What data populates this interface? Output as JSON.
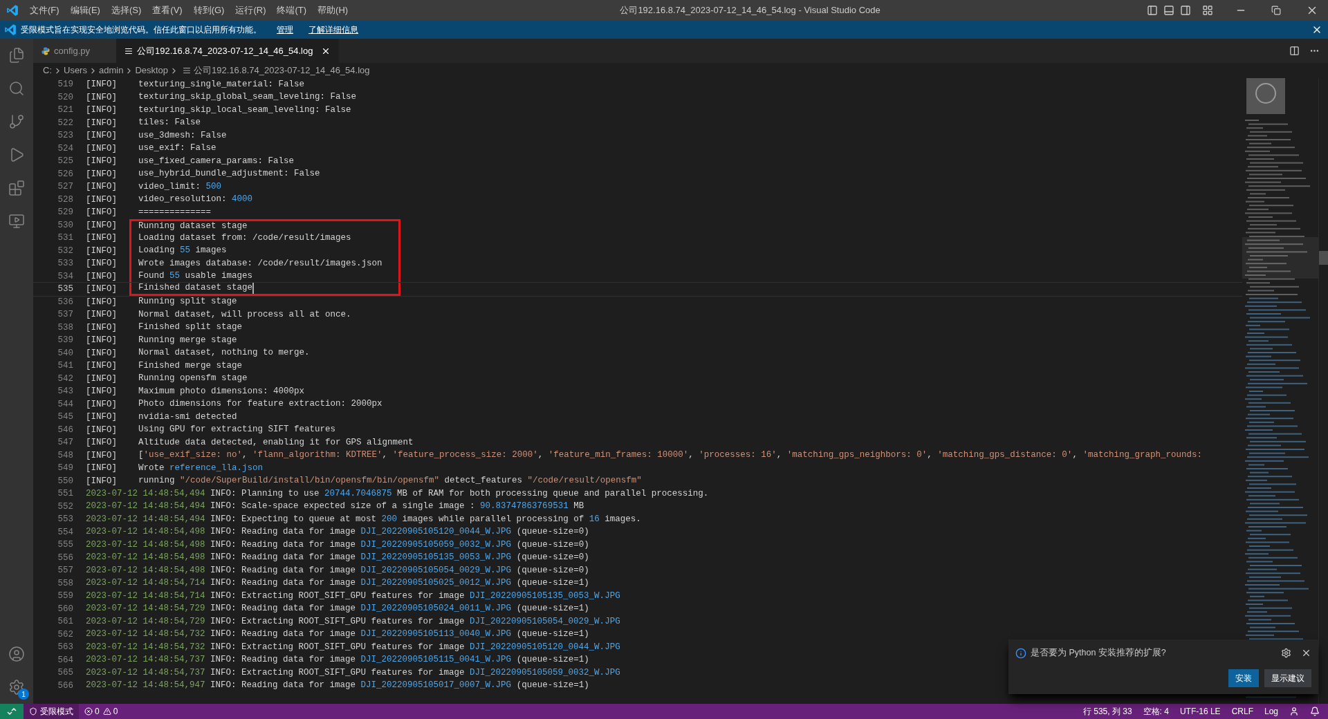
{
  "window": {
    "title": "公司192.16.8.74_2023-07-12_14_46_54.log - Visual Studio Code"
  },
  "menu": [
    "文件(F)",
    "编辑(E)",
    "选择(S)",
    "查看(V)",
    "转到(G)",
    "运行(R)",
    "终端(T)",
    "帮助(H)"
  ],
  "banner": {
    "text": "受限模式旨在实现安全地浏览代码。信任此窗口以启用所有功能。",
    "links": [
      "管理",
      "了解详细信息"
    ]
  },
  "activity_bar": {
    "settings_badge": "1"
  },
  "tabs": [
    {
      "label": "config.py",
      "kind": "python",
      "selected": false
    },
    {
      "label": "公司192.16.8.74_2023-07-12_14_46_54.log",
      "kind": "log",
      "selected": true
    }
  ],
  "breadcrumb": [
    "C:",
    "Users",
    "admin",
    "Desktop",
    "公司192.16.8.74_2023-07-12_14_46_54.log"
  ],
  "lines": [
    {
      "n": "519",
      "level": "[INFO]",
      "current": false,
      "boxed": false,
      "msg": [
        {
          "kind": "plain",
          "text": "texturing_single_material: False"
        }
      ]
    },
    {
      "n": "520",
      "level": "[INFO]",
      "current": false,
      "boxed": false,
      "msg": [
        {
          "kind": "plain",
          "text": "texturing_skip_global_seam_leveling: False"
        }
      ]
    },
    {
      "n": "521",
      "level": "[INFO]",
      "current": false,
      "boxed": false,
      "msg": [
        {
          "kind": "plain",
          "text": "texturing_skip_local_seam_leveling: False"
        }
      ]
    },
    {
      "n": "522",
      "level": "[INFO]",
      "current": false,
      "boxed": false,
      "msg": [
        {
          "kind": "plain",
          "text": "tiles: False"
        }
      ]
    },
    {
      "n": "523",
      "level": "[INFO]",
      "current": false,
      "boxed": false,
      "msg": [
        {
          "kind": "plain",
          "text": "use_3dmesh: False"
        }
      ]
    },
    {
      "n": "524",
      "level": "[INFO]",
      "current": false,
      "boxed": false,
      "msg": [
        {
          "kind": "plain",
          "text": "use_exif: False"
        }
      ]
    },
    {
      "n": "525",
      "level": "[INFO]",
      "current": false,
      "boxed": false,
      "msg": [
        {
          "kind": "plain",
          "text": "use_fixed_camera_params: False"
        }
      ]
    },
    {
      "n": "526",
      "level": "[INFO]",
      "current": false,
      "boxed": false,
      "msg": [
        {
          "kind": "plain",
          "text": "use_hybrid_bundle_adjustment: False"
        }
      ]
    },
    {
      "n": "527",
      "level": "[INFO]",
      "current": false,
      "boxed": false,
      "msg": [
        {
          "kind": "plain",
          "text": "video_limit: "
        },
        {
          "kind": "number",
          "text": "500"
        }
      ]
    },
    {
      "n": "528",
      "level": "[INFO]",
      "current": false,
      "boxed": false,
      "msg": [
        {
          "kind": "plain",
          "text": "video_resolution: "
        },
        {
          "kind": "number",
          "text": "4000"
        }
      ]
    },
    {
      "n": "529",
      "level": "[INFO]",
      "current": false,
      "boxed": false,
      "msg": [
        {
          "kind": "plain",
          "text": "=============="
        }
      ]
    },
    {
      "n": "530",
      "level": "[INFO]",
      "current": false,
      "boxed": true,
      "msg": [
        {
          "kind": "plain",
          "text": "Running dataset stage"
        }
      ]
    },
    {
      "n": "531",
      "level": "[INFO]",
      "current": false,
      "boxed": true,
      "msg": [
        {
          "kind": "plain",
          "text": "Loading dataset from: /code/result/images"
        }
      ]
    },
    {
      "n": "532",
      "level": "[INFO]",
      "current": false,
      "boxed": true,
      "msg": [
        {
          "kind": "plain",
          "text": "Loading "
        },
        {
          "kind": "number",
          "text": "55"
        },
        {
          "kind": "plain",
          "text": " images"
        }
      ]
    },
    {
      "n": "533",
      "level": "[INFO]",
      "current": false,
      "boxed": true,
      "msg": [
        {
          "kind": "plain",
          "text": "Wrote images database: /code/result/images.json"
        }
      ]
    },
    {
      "n": "534",
      "level": "[INFO]",
      "current": false,
      "boxed": true,
      "msg": [
        {
          "kind": "plain",
          "text": "Found "
        },
        {
          "kind": "number",
          "text": "55"
        },
        {
          "kind": "plain",
          "text": " usable images"
        }
      ]
    },
    {
      "n": "535",
      "level": "[INFO]",
      "current": true,
      "boxed": true,
      "msg": [
        {
          "kind": "plain",
          "text": "Finished dataset stage"
        }
      ]
    },
    {
      "n": "536",
      "level": "[INFO]",
      "current": false,
      "boxed": false,
      "msg": [
        {
          "kind": "plain",
          "text": "Running split stage"
        }
      ]
    },
    {
      "n": "537",
      "level": "[INFO]",
      "current": false,
      "boxed": false,
      "msg": [
        {
          "kind": "plain",
          "text": "Normal dataset, will process all at once."
        }
      ]
    },
    {
      "n": "538",
      "level": "[INFO]",
      "current": false,
      "boxed": false,
      "msg": [
        {
          "kind": "plain",
          "text": "Finished split stage"
        }
      ]
    },
    {
      "n": "539",
      "level": "[INFO]",
      "current": false,
      "boxed": false,
      "msg": [
        {
          "kind": "plain",
          "text": "Running merge stage"
        }
      ]
    },
    {
      "n": "540",
      "level": "[INFO]",
      "current": false,
      "boxed": false,
      "msg": [
        {
          "kind": "plain",
          "text": "Normal dataset, nothing to merge."
        }
      ]
    },
    {
      "n": "541",
      "level": "[INFO]",
      "current": false,
      "boxed": false,
      "msg": [
        {
          "kind": "plain",
          "text": "Finished merge stage"
        }
      ]
    },
    {
      "n": "542",
      "level": "[INFO]",
      "current": false,
      "boxed": false,
      "msg": [
        {
          "kind": "plain",
          "text": "Running opensfm stage"
        }
      ]
    },
    {
      "n": "543",
      "level": "[INFO]",
      "current": false,
      "boxed": false,
      "msg": [
        {
          "kind": "plain",
          "text": "Maximum photo dimensions: 4000px"
        }
      ]
    },
    {
      "n": "544",
      "level": "[INFO]",
      "current": false,
      "boxed": false,
      "msg": [
        {
          "kind": "plain",
          "text": "Photo dimensions for feature extraction: 2000px"
        }
      ]
    },
    {
      "n": "545",
      "level": "[INFO]",
      "current": false,
      "boxed": false,
      "msg": [
        {
          "kind": "plain",
          "text": "nvidia-smi detected"
        }
      ]
    },
    {
      "n": "546",
      "level": "[INFO]",
      "current": false,
      "boxed": false,
      "msg": [
        {
          "kind": "plain",
          "text": "Using GPU for extracting SIFT features"
        }
      ]
    },
    {
      "n": "547",
      "level": "[INFO]",
      "current": false,
      "boxed": false,
      "msg": [
        {
          "kind": "plain",
          "text": "Altitude data detected, enabling it for GPS alignment"
        }
      ]
    },
    {
      "n": "548",
      "level": "[INFO]",
      "current": false,
      "boxed": false,
      "msg": [
        {
          "kind": "plain",
          "text": "["
        },
        {
          "kind": "string",
          "text": "'use_exif_size: no'"
        },
        {
          "kind": "plain",
          "text": ", "
        },
        {
          "kind": "string",
          "text": "'flann_algorithm: KDTREE'"
        },
        {
          "kind": "plain",
          "text": ", "
        },
        {
          "kind": "string",
          "text": "'feature_process_size: 2000'"
        },
        {
          "kind": "plain",
          "text": ", "
        },
        {
          "kind": "string",
          "text": "'feature_min_frames: 10000'"
        },
        {
          "kind": "plain",
          "text": ", "
        },
        {
          "kind": "string",
          "text": "'processes: 16'"
        },
        {
          "kind": "plain",
          "text": ", "
        },
        {
          "kind": "string",
          "text": "'matching_gps_neighbors: 0'"
        },
        {
          "kind": "plain",
          "text": ", "
        },
        {
          "kind": "string",
          "text": "'matching_gps_distance: 0'"
        },
        {
          "kind": "plain",
          "text": ", "
        },
        {
          "kind": "string",
          "text": "'matching_graph_rounds:"
        }
      ]
    },
    {
      "n": "549",
      "level": "[INFO]",
      "current": false,
      "boxed": false,
      "msg": [
        {
          "kind": "plain",
          "text": "Wrote "
        },
        {
          "kind": "path",
          "text": "reference_lla.json"
        }
      ]
    },
    {
      "n": "550",
      "level": "[INFO]",
      "current": false,
      "boxed": false,
      "msg": [
        {
          "kind": "plain",
          "text": "running "
        },
        {
          "kind": "string",
          "text": "\"/code/SuperBuild/install/bin/opensfm/bin/opensfm\""
        },
        {
          "kind": "plain",
          "text": " detect_features "
        },
        {
          "kind": "string",
          "text": "\"/code/result/opensfm\""
        }
      ]
    },
    {
      "n": "551",
      "current": false,
      "boxed": false,
      "msg": [
        {
          "kind": "date",
          "text": "2023-07-12 14:48:54,494"
        },
        {
          "kind": "plain",
          "text": " INFO: Planning to use "
        },
        {
          "kind": "number",
          "text": "20744.7046875"
        },
        {
          "kind": "plain",
          "text": " MB of RAM for both processing queue and parallel processing."
        }
      ]
    },
    {
      "n": "552",
      "current": false,
      "boxed": false,
      "msg": [
        {
          "kind": "date",
          "text": "2023-07-12 14:48:54,494"
        },
        {
          "kind": "plain",
          "text": " INFO: Scale-space expected size of a single image : "
        },
        {
          "kind": "number",
          "text": "90.83747863769531"
        },
        {
          "kind": "plain",
          "text": " MB"
        }
      ]
    },
    {
      "n": "553",
      "current": false,
      "boxed": false,
      "msg": [
        {
          "kind": "date",
          "text": "2023-07-12 14:48:54,494"
        },
        {
          "kind": "plain",
          "text": " INFO: Expecting to queue at most "
        },
        {
          "kind": "number",
          "text": "200"
        },
        {
          "kind": "plain",
          "text": " images while parallel processing of "
        },
        {
          "kind": "number",
          "text": "16"
        },
        {
          "kind": "plain",
          "text": " images."
        }
      ]
    },
    {
      "n": "554",
      "current": false,
      "boxed": false,
      "msg": [
        {
          "kind": "date",
          "text": "2023-07-12 14:48:54,498"
        },
        {
          "kind": "plain",
          "text": " INFO: Reading data for image "
        },
        {
          "kind": "path",
          "text": "DJI_20220905105120_0044_W.JPG"
        },
        {
          "kind": "plain",
          "text": " (queue-size=0)"
        }
      ]
    },
    {
      "n": "555",
      "current": false,
      "boxed": false,
      "msg": [
        {
          "kind": "date",
          "text": "2023-07-12 14:48:54,498"
        },
        {
          "kind": "plain",
          "text": " INFO: Reading data for image "
        },
        {
          "kind": "path",
          "text": "DJI_20220905105059_0032_W.JPG"
        },
        {
          "kind": "plain",
          "text": " (queue-size=0)"
        }
      ]
    },
    {
      "n": "556",
      "current": false,
      "boxed": false,
      "msg": [
        {
          "kind": "date",
          "text": "2023-07-12 14:48:54,498"
        },
        {
          "kind": "plain",
          "text": " INFO: Reading data for image "
        },
        {
          "kind": "path",
          "text": "DJI_20220905105135_0053_W.JPG"
        },
        {
          "kind": "plain",
          "text": " (queue-size=0)"
        }
      ]
    },
    {
      "n": "557",
      "current": false,
      "boxed": false,
      "msg": [
        {
          "kind": "date",
          "text": "2023-07-12 14:48:54,498"
        },
        {
          "kind": "plain",
          "text": " INFO: Reading data for image "
        },
        {
          "kind": "path",
          "text": "DJI_20220905105054_0029_W.JPG"
        },
        {
          "kind": "plain",
          "text": " (queue-size=0)"
        }
      ]
    },
    {
      "n": "558",
      "current": false,
      "boxed": false,
      "msg": [
        {
          "kind": "date",
          "text": "2023-07-12 14:48:54,714"
        },
        {
          "kind": "plain",
          "text": " INFO: Reading data for image "
        },
        {
          "kind": "path",
          "text": "DJI_20220905105025_0012_W.JPG"
        },
        {
          "kind": "plain",
          "text": " (queue-size=1)"
        }
      ]
    },
    {
      "n": "559",
      "current": false,
      "boxed": false,
      "msg": [
        {
          "kind": "date",
          "text": "2023-07-12 14:48:54,714"
        },
        {
          "kind": "plain",
          "text": " INFO: Extracting ROOT_SIFT_GPU features for image "
        },
        {
          "kind": "path",
          "text": "DJI_20220905105135_0053_W.JPG"
        }
      ]
    },
    {
      "n": "560",
      "current": false,
      "boxed": false,
      "msg": [
        {
          "kind": "date",
          "text": "2023-07-12 14:48:54,729"
        },
        {
          "kind": "plain",
          "text": " INFO: Reading data for image "
        },
        {
          "kind": "path",
          "text": "DJI_20220905105024_0011_W.JPG"
        },
        {
          "kind": "plain",
          "text": " (queue-size=1)"
        }
      ]
    },
    {
      "n": "561",
      "current": false,
      "boxed": false,
      "msg": [
        {
          "kind": "date",
          "text": "2023-07-12 14:48:54,729"
        },
        {
          "kind": "plain",
          "text": " INFO: Extracting ROOT_SIFT_GPU features for image "
        },
        {
          "kind": "path",
          "text": "DJI_20220905105054_0029_W.JPG"
        }
      ]
    },
    {
      "n": "562",
      "current": false,
      "boxed": false,
      "msg": [
        {
          "kind": "date",
          "text": "2023-07-12 14:48:54,732"
        },
        {
          "kind": "plain",
          "text": " INFO: Reading data for image "
        },
        {
          "kind": "path",
          "text": "DJI_20220905105113_0040_W.JPG"
        },
        {
          "kind": "plain",
          "text": " (queue-size=1)"
        }
      ]
    },
    {
      "n": "563",
      "current": false,
      "boxed": false,
      "msg": [
        {
          "kind": "date",
          "text": "2023-07-12 14:48:54,732"
        },
        {
          "kind": "plain",
          "text": " INFO: Extracting ROOT_SIFT_GPU features for image "
        },
        {
          "kind": "path",
          "text": "DJI_20220905105120_0044_W.JPG"
        }
      ]
    },
    {
      "n": "564",
      "current": false,
      "boxed": false,
      "msg": [
        {
          "kind": "date",
          "text": "2023-07-12 14:48:54,737"
        },
        {
          "kind": "plain",
          "text": " INFO: Reading data for image "
        },
        {
          "kind": "path",
          "text": "DJI_20220905105115_0041_W.JPG"
        },
        {
          "kind": "plain",
          "text": " (queue-size=1)"
        }
      ]
    },
    {
      "n": "565",
      "current": false,
      "boxed": false,
      "msg": [
        {
          "kind": "date",
          "text": "2023-07-12 14:48:54,737"
        },
        {
          "kind": "plain",
          "text": " INFO: Extracting ROOT_SIFT_GPU features for image "
        },
        {
          "kind": "path",
          "text": "DJI_20220905105059_0032_W.JPG"
        }
      ]
    },
    {
      "n": "566",
      "current": false,
      "boxed": false,
      "msg": [
        {
          "kind": "date",
          "text": "2023-07-12 14:48:54,947"
        },
        {
          "kind": "plain",
          "text": " INFO: Reading data for image "
        },
        {
          "kind": "path",
          "text": "DJI_20220905105017_0007_W.JPG"
        },
        {
          "kind": "plain",
          "text": " (queue-size=1)"
        }
      ]
    }
  ],
  "notification": {
    "message": "是否要为 Python 安装推荐的扩展?",
    "buttons": [
      {
        "label": "安装",
        "kind": "primary"
      },
      {
        "label": "显示建议",
        "kind": "secondary"
      }
    ]
  },
  "status_bar": {
    "mode": "受限模式",
    "errors": "0",
    "warnings": "0",
    "items": [
      "行 535, 列 33",
      "空格: 4",
      "UTF-16 LE",
      "CRLF",
      "Log"
    ]
  }
}
